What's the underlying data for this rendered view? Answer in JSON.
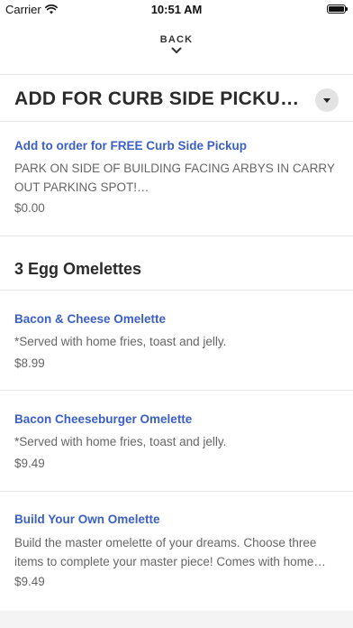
{
  "status_bar": {
    "carrier": "Carrier",
    "time": "10:51 AM",
    "wifi_icon": "wifi-icon",
    "battery_icon": "battery-icon"
  },
  "nav": {
    "back_label": "BACK",
    "back_icon": "chevron-down-icon"
  },
  "category": {
    "title": "ADD FOR CURB SIDE PICKU…",
    "dropdown_icon": "triangle-down-icon"
  },
  "curbside_item": {
    "name": "Add to order for FREE Curb Side Pickup",
    "description": "PARK ON SIDE OF BUILDING FACING ARBYS IN CARRY OUT PARKING SPOT!…",
    "price": "$0.00"
  },
  "section": {
    "title": "3 Egg Omelettes"
  },
  "items": [
    {
      "name": "Bacon & Cheese Omelette",
      "description": "*Served with home fries, toast and jelly.",
      "price": "$8.99"
    },
    {
      "name": "Bacon Cheeseburger Omelette",
      "description": "*Served with home fries, toast and jelly.",
      "price": "$9.49"
    },
    {
      "name": "Build Your Own Omelette",
      "description": "Build the master omelette of your dreams.  Choose three items to complete your master piece! Comes with home…",
      "price": "$9.49"
    }
  ],
  "colors": {
    "link": "#3a5fc8",
    "text_dark": "#2b2b2b",
    "text_muted": "#666666",
    "divider": "#e6e6e6"
  }
}
